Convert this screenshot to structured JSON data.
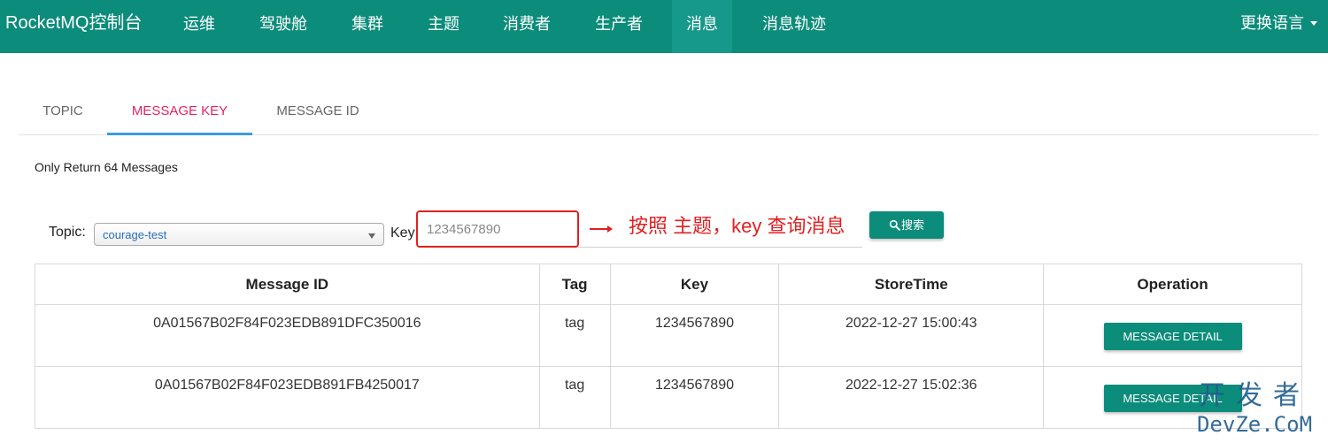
{
  "navbar": {
    "brand": "RocketMQ控制台",
    "items": [
      {
        "label": "运维"
      },
      {
        "label": "驾驶舱"
      },
      {
        "label": "集群"
      },
      {
        "label": "主题"
      },
      {
        "label": "消费者"
      },
      {
        "label": "生产者"
      },
      {
        "label": "消息",
        "active": true
      },
      {
        "label": "消息轨迹"
      }
    ],
    "language": "更换语言"
  },
  "tabs": [
    {
      "label": "TOPIC"
    },
    {
      "label": "MESSAGE KEY",
      "active": true
    },
    {
      "label": "MESSAGE ID"
    }
  ],
  "notice": "Only Return 64 Messages",
  "search": {
    "topic_label": "Topic:",
    "topic_value": "courage-test",
    "key_label": "Key:",
    "key_value": "1234567890",
    "button_label": "搜索",
    "annotation": "按照 主题，key 查询消息"
  },
  "table": {
    "headers": [
      "Message ID",
      "Tag",
      "Key",
      "StoreTime",
      "Operation"
    ],
    "rows": [
      {
        "message_id": "0A01567B02F84F023EDB891DFC350016",
        "tag": "tag",
        "key": "1234567890",
        "store_time": "2022-12-27 15:00:43",
        "operation": "MESSAGE DETAIL"
      },
      {
        "message_id": "0A01567B02F84F023EDB891FB4250017",
        "tag": "tag",
        "key": "1234567890",
        "store_time": "2022-12-27 15:02:36",
        "operation": "MESSAGE DETAIL"
      }
    ]
  },
  "watermark": {
    "cn": "开发者",
    "en": "DevZe.CoM"
  },
  "colors": {
    "primary": "#0c8c7a",
    "active_tab_text": "#e0245e",
    "tab_underline": "#3a9edb",
    "annotation": "#e02020"
  }
}
